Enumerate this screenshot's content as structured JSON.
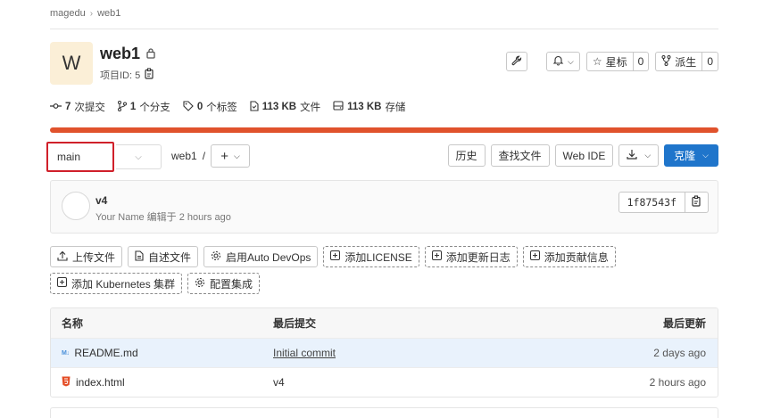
{
  "breadcrumb": {
    "group": "magedu",
    "project": "web1"
  },
  "project": {
    "avatar_letter": "W",
    "name": "web1",
    "id_label": "项目ID: 5"
  },
  "header_actions": {
    "notification_icon": "bell-icon",
    "star": {
      "label": "星标",
      "count": "0"
    },
    "fork": {
      "label": "派生",
      "count": "0"
    }
  },
  "stats": [
    {
      "icon": "commit-icon",
      "value": "7",
      "label": "次提交"
    },
    {
      "icon": "branch-icon",
      "value": "1",
      "label": "个分支"
    },
    {
      "icon": "tag-icon",
      "value": "0",
      "label": "个标签"
    },
    {
      "icon": "file-icon",
      "value": "113 KB",
      "label": "文件"
    },
    {
      "icon": "storage-icon",
      "value": "113 KB",
      "label": "存储"
    }
  ],
  "storage_bar_color": "#e0522c",
  "repo_nav": {
    "branch": "main",
    "path_root": "web1",
    "path_sep": "/",
    "add_label": "+"
  },
  "toolbar": {
    "history": "历史",
    "find_file": "查找文件",
    "web_ide": "Web IDE",
    "clone": "克隆"
  },
  "last_commit": {
    "title": "v4",
    "meta": "Your Name 编辑于 2 hours ago",
    "sha": "1f87543f"
  },
  "shortcuts": [
    {
      "label": "上传文件",
      "icon": "upload-icon",
      "style": "solid"
    },
    {
      "label": "自述文件",
      "icon": "file-icon",
      "style": "solid"
    },
    {
      "label": "启用Auto DevOps",
      "icon": "gear-icon",
      "style": "solid"
    },
    {
      "label": "添加LICENSE",
      "icon": "plus-square-icon",
      "style": "dashed"
    },
    {
      "label": "添加更新日志",
      "icon": "plus-square-icon",
      "style": "dashed"
    },
    {
      "label": "添加贡献信息",
      "icon": "plus-square-icon",
      "style": "dashed"
    },
    {
      "label": "添加 Kubernetes 集群",
      "icon": "plus-square-icon",
      "style": "dashed"
    },
    {
      "label": "配置集成",
      "icon": "gear-icon",
      "style": "dashed"
    }
  ],
  "file_table": {
    "headers": {
      "name": "名称",
      "last_commit": "最后提交",
      "last_update": "最后更新"
    },
    "rows": [
      {
        "icon": "markdown-icon",
        "name": "README.md",
        "commit": "Initial commit",
        "commit_link": true,
        "updated": "2 days ago"
      },
      {
        "icon": "html5-icon",
        "name": "index.html",
        "commit": "v4",
        "commit_link": false,
        "updated": "2 hours ago"
      }
    ]
  }
}
